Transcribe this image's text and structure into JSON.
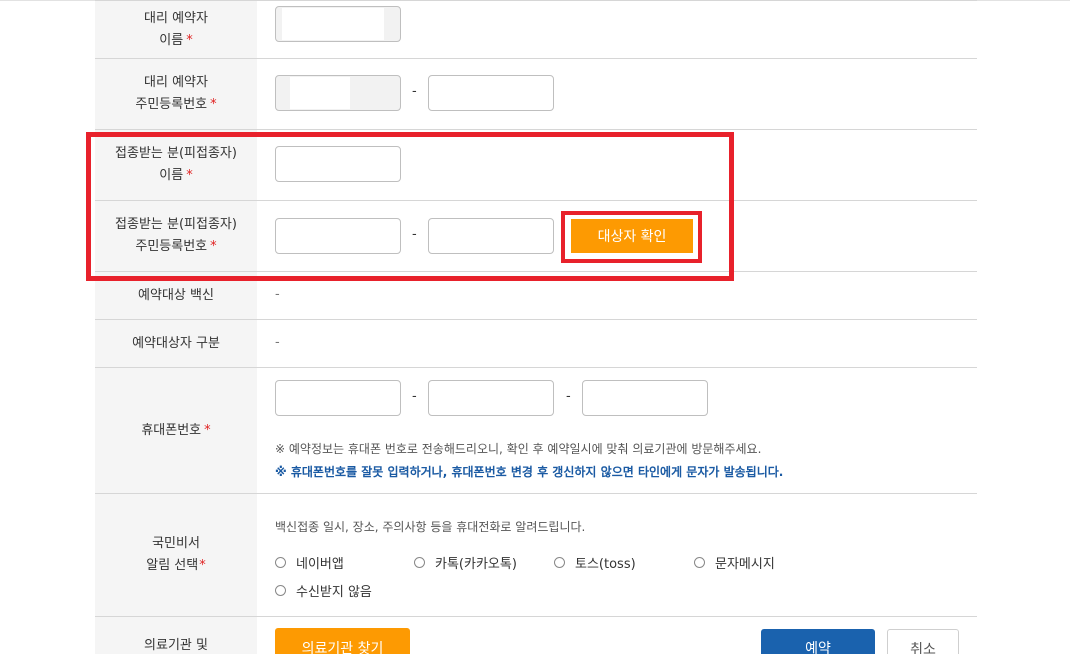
{
  "required_mark": "*",
  "proxy_name": {
    "label_line1": "대리 예약자",
    "label_line2": "이름"
  },
  "proxy_rrn": {
    "label_line1": "대리 예약자",
    "label_line2": "주민등록번호",
    "separator": "-"
  },
  "recipient_name": {
    "label_line1": "접종받는 분(피접종자)",
    "label_line2": "이름"
  },
  "recipient_rrn": {
    "label_line1": "접종받는 분(피접종자)",
    "label_line2": "주민등록번호",
    "separator": "-",
    "verify_button": "대상자 확인"
  },
  "vaccine": {
    "label": "예약대상 백신",
    "value": "-"
  },
  "category": {
    "label": "예약대상자 구분",
    "value": "-"
  },
  "phone": {
    "label": "휴대폰번호",
    "separator1": "-",
    "separator2": "-",
    "note1": "※ 예약정보는 휴대폰 번호로 전송해드리오니, 확인 후 예약일시에 맞춰 의료기관에 방문해주세요.",
    "note2": "※ 휴대폰번호를 잘못 입력하거나, 휴대폰번호 변경 후 갱신하지 않으면 타인에게 문자가 발송됩니다."
  },
  "notify": {
    "label_line1": "국민비서",
    "label_line2": "알림 선택",
    "description": "백신접종 일시, 장소, 주의사항 등을 휴대전화로 알려드립니다.",
    "options": [
      "네이버앱",
      "카톡(카카오톡)",
      "토스(toss)",
      "문자메시지",
      "수신받지 않음"
    ]
  },
  "facility": {
    "label_line1": "의료기관 및",
    "find_button": "의료기관 찾기"
  },
  "actions": {
    "reserve": "예약",
    "cancel": "취소"
  },
  "colors": {
    "accent_orange": "#fd9a02",
    "highlight_red": "#e8212b",
    "primary_blue": "#1a62ae",
    "warning_blue": "#1a5aa3"
  }
}
